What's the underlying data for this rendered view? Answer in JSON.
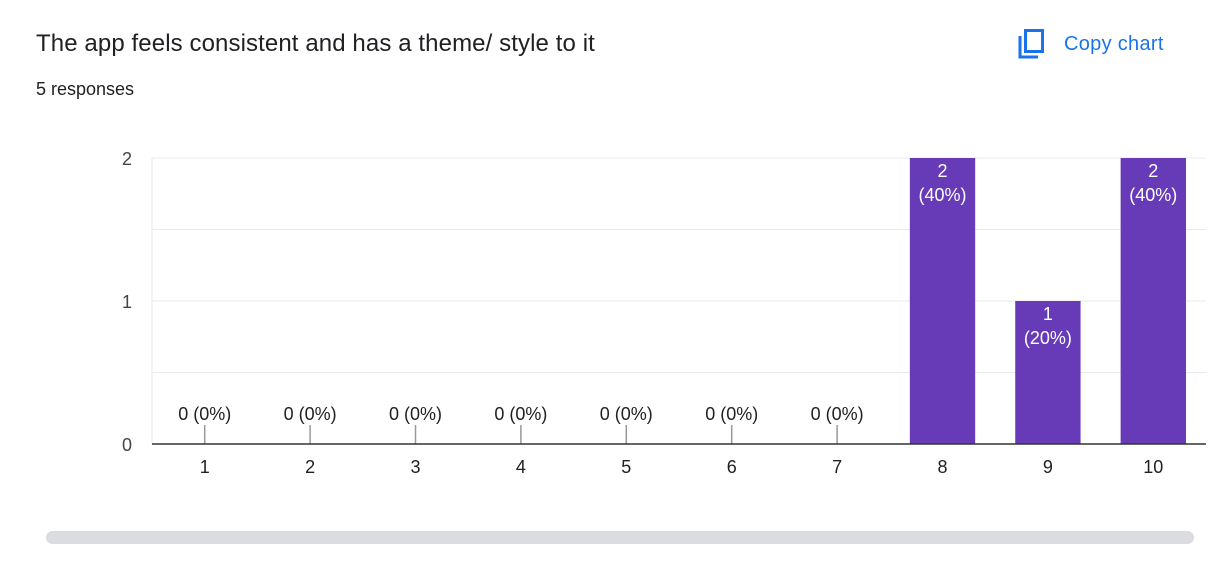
{
  "header": {
    "question_title": "The app feels consistent and has a theme/ style to it",
    "response_count": "5 responses",
    "copy_chart_label": "Copy chart"
  },
  "colors": {
    "bar": "#673ab7",
    "accent": "#1a73e8",
    "text": "#202124",
    "grid": "#e8eaed"
  },
  "icons": {
    "copy": "copy-icon"
  },
  "chart_data": {
    "type": "bar",
    "categories": [
      "1",
      "2",
      "3",
      "4",
      "5",
      "6",
      "7",
      "8",
      "9",
      "10"
    ],
    "values": [
      0,
      0,
      0,
      0,
      0,
      0,
      0,
      2,
      1,
      2
    ],
    "data_labels": [
      "0 (0%)",
      "0 (0%)",
      "0 (0%)",
      "0 (0%)",
      "0 (0%)",
      "0 (0%)",
      "0 (0%)",
      "2\n(40%)",
      "1\n(20%)",
      "2\n(40%)"
    ],
    "ylim": [
      0,
      2
    ],
    "yticks": [
      "0",
      "1",
      "2"
    ],
    "grid": true,
    "title": "",
    "xlabel": "",
    "ylabel": ""
  }
}
